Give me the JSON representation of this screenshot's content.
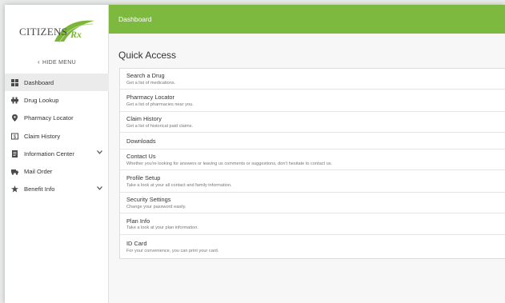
{
  "logo": {
    "text": "CITIZENS",
    "rx": "Rx"
  },
  "sidebar": {
    "hide_menu": "HIDE MENU",
    "items": [
      {
        "label": "Dashboard",
        "icon": "dashboard-icon",
        "has_caret": false
      },
      {
        "label": "Drug Lookup",
        "icon": "pill-icon",
        "has_caret": false
      },
      {
        "label": "Pharmacy Locator",
        "icon": "map-pin-icon",
        "has_caret": false
      },
      {
        "label": "Claim History",
        "icon": "dollar-icon",
        "has_caret": false
      },
      {
        "label": "Information Center",
        "icon": "document-icon",
        "has_caret": true
      },
      {
        "label": "Mail Order",
        "icon": "truck-icon",
        "has_caret": false
      },
      {
        "label": "Benefit Info",
        "icon": "star-icon",
        "has_caret": true
      }
    ]
  },
  "header": {
    "title": "Dashboard"
  },
  "main": {
    "title": "Quick Access",
    "items": [
      {
        "title": "Search a Drug",
        "desc": "Get a list of medications."
      },
      {
        "title": "Pharmacy Locator",
        "desc": "Get a list of pharmacies near you."
      },
      {
        "title": "Claim History",
        "desc": "Get a list of historical paid claims."
      },
      {
        "title": "Downloads",
        "desc": ""
      },
      {
        "title": "Contact Us",
        "desc": "Whether you're looking for answers or leaving us comments or suggestions, don't hesitate to contact us."
      },
      {
        "title": "Profile Setup",
        "desc": "Take a look at your all contact and family information."
      },
      {
        "title": "Security Settings",
        "desc": "Change your password easily."
      },
      {
        "title": "Plan Info",
        "desc": "Take a look at your plan information."
      },
      {
        "title": "ID Card",
        "desc": "For your convenience, you can print your card."
      }
    ]
  },
  "colors": {
    "accent": "#7db83f",
    "active_bg": "#ebebeb",
    "icon": "#4a4a4a"
  }
}
